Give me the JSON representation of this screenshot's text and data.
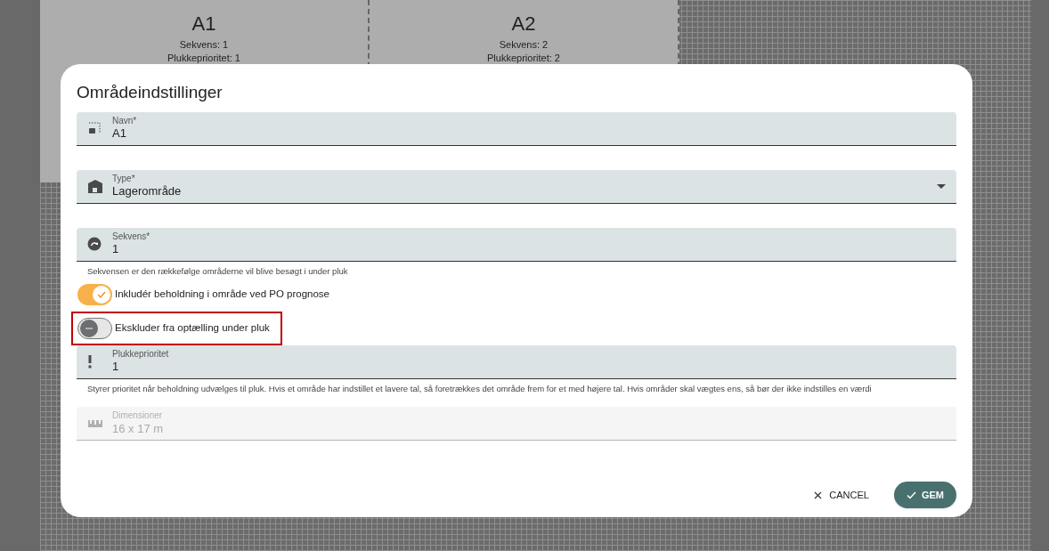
{
  "background_areas": [
    {
      "name": "A1",
      "lines": [
        "Sekvens: 1",
        "Plukkeprioritet: 1"
      ]
    },
    {
      "name": "A2",
      "lines": [
        "Sekvens: 2",
        "Plukkeprioritet: 2"
      ]
    }
  ],
  "dialog": {
    "title": "Områdeindstillinger",
    "items": [
      {
        "kind": "field",
        "label": "Navn*",
        "value": "A1",
        "disabled": false
      },
      {
        "kind": "select",
        "label": "Type*",
        "value": "Lagerområde",
        "disabled": false
      },
      {
        "kind": "field",
        "label": "Sekvens*",
        "value": "1",
        "disabled": false,
        "helper": "Sekvensen er den rækkefølge områderne vil blive besøgt i under pluk"
      },
      {
        "kind": "toggle",
        "label": "Inkludér beholdning i område ved PO prognose",
        "on": true,
        "highlighted": false
      },
      {
        "kind": "toggle",
        "label": "Ekskluder fra optælling under pluk",
        "on": false,
        "highlighted": true
      },
      {
        "kind": "field",
        "label": "Plukkeprioritet",
        "value": "1",
        "disabled": false,
        "helper": "Styrer prioritet når beholdning udvælges til pluk. Hvis et område har indstillet et lavere tal, så foretrækkes det område frem for et med højere tal. Hvis områder skal vægtes ens, så bør der ikke indstilles en værdi"
      },
      {
        "kind": "field",
        "label": "Dimensioner",
        "value": "16 x 17 m",
        "disabled": true
      }
    ],
    "buttons": [
      {
        "kind": "text",
        "label": "CANCEL"
      },
      {
        "kind": "primary",
        "label": "GEM"
      }
    ]
  }
}
